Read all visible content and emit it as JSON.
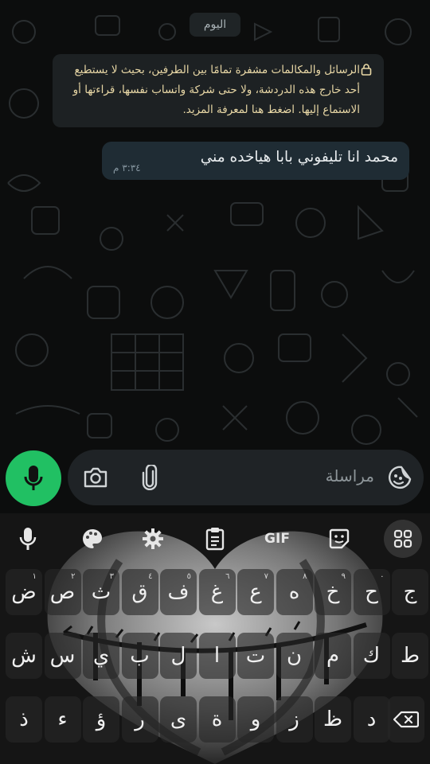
{
  "chat": {
    "date_chip": "اليوم",
    "encryption_notice": "الرسائل والمكالمات مشفرة تمامًا بين الطرفين، بحيث لا يستطيع أحد خارج هذه الدردشة، ولا حتى شركة واتساب نفسها، قراءتها أو الاستماع إليها. اضغط هنا لمعرفة المزيد.",
    "messages": [
      {
        "text": "محمد انا تليفوني بابا هياخده مني",
        "time": "٣:٣٤ م"
      }
    ]
  },
  "composer": {
    "placeholder": "مراسلة",
    "icons": {
      "emoji": "sticker-smile-icon",
      "attach": "paperclip-icon",
      "camera": "camera-icon",
      "mic": "microphone-icon"
    }
  },
  "keyboard": {
    "toolbar": {
      "gif": "GIF",
      "icons": [
        "microphone-icon",
        "palette-icon",
        "gear-icon",
        "clipboard-icon",
        "gif-icon",
        "sticker-icon",
        "grid-icon"
      ]
    },
    "row1": [
      {
        "k": "ض",
        "h": "١"
      },
      {
        "k": "ص",
        "h": "٢"
      },
      {
        "k": "ث",
        "h": "٣"
      },
      {
        "k": "ق",
        "h": "٤"
      },
      {
        "k": "ف",
        "h": "٥"
      },
      {
        "k": "غ",
        "h": "٦"
      },
      {
        "k": "ع",
        "h": "٧"
      },
      {
        "k": "ه",
        "h": "٨"
      },
      {
        "k": "خ",
        "h": "٩"
      },
      {
        "k": "ح",
        "h": "٠"
      },
      {
        "k": "ج",
        "h": ""
      }
    ],
    "row2": [
      "ش",
      "س",
      "ي",
      "ب",
      "ل",
      "ا",
      "ت",
      "ن",
      "م",
      "ك",
      "ط"
    ],
    "row3": [
      "ذ",
      "ء",
      "ؤ",
      "ر",
      "ى",
      "ة",
      "و",
      "ز",
      "ظ",
      "د"
    ],
    "accent_color": "#21c063"
  }
}
